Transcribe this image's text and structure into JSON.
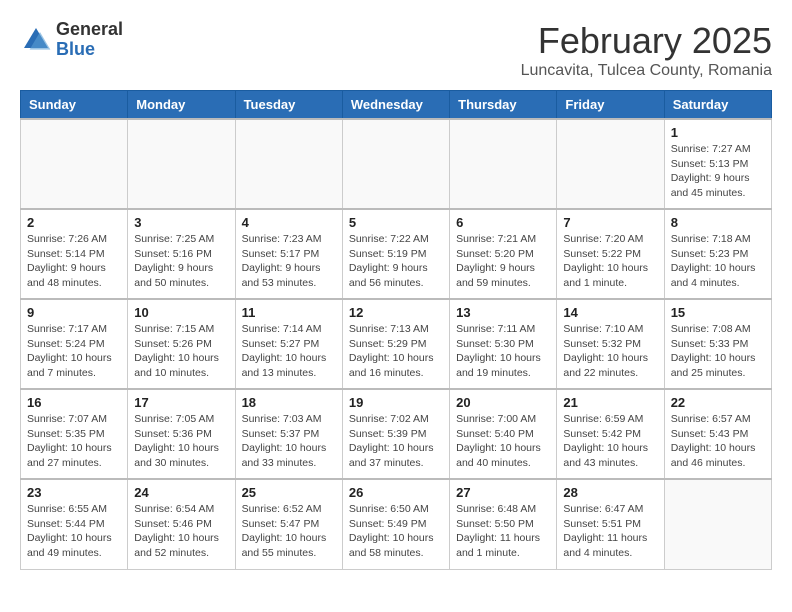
{
  "header": {
    "logo_general": "General",
    "logo_blue": "Blue",
    "month_title": "February 2025",
    "location": "Luncavita, Tulcea County, Romania"
  },
  "weekdays": [
    "Sunday",
    "Monday",
    "Tuesday",
    "Wednesday",
    "Thursday",
    "Friday",
    "Saturday"
  ],
  "weeks": [
    [
      {
        "day": "",
        "info": ""
      },
      {
        "day": "",
        "info": ""
      },
      {
        "day": "",
        "info": ""
      },
      {
        "day": "",
        "info": ""
      },
      {
        "day": "",
        "info": ""
      },
      {
        "day": "",
        "info": ""
      },
      {
        "day": "1",
        "info": "Sunrise: 7:27 AM\nSunset: 5:13 PM\nDaylight: 9 hours\nand 45 minutes."
      }
    ],
    [
      {
        "day": "2",
        "info": "Sunrise: 7:26 AM\nSunset: 5:14 PM\nDaylight: 9 hours\nand 48 minutes."
      },
      {
        "day": "3",
        "info": "Sunrise: 7:25 AM\nSunset: 5:16 PM\nDaylight: 9 hours\nand 50 minutes."
      },
      {
        "day": "4",
        "info": "Sunrise: 7:23 AM\nSunset: 5:17 PM\nDaylight: 9 hours\nand 53 minutes."
      },
      {
        "day": "5",
        "info": "Sunrise: 7:22 AM\nSunset: 5:19 PM\nDaylight: 9 hours\nand 56 minutes."
      },
      {
        "day": "6",
        "info": "Sunrise: 7:21 AM\nSunset: 5:20 PM\nDaylight: 9 hours\nand 59 minutes."
      },
      {
        "day": "7",
        "info": "Sunrise: 7:20 AM\nSunset: 5:22 PM\nDaylight: 10 hours\nand 1 minute."
      },
      {
        "day": "8",
        "info": "Sunrise: 7:18 AM\nSunset: 5:23 PM\nDaylight: 10 hours\nand 4 minutes."
      }
    ],
    [
      {
        "day": "9",
        "info": "Sunrise: 7:17 AM\nSunset: 5:24 PM\nDaylight: 10 hours\nand 7 minutes."
      },
      {
        "day": "10",
        "info": "Sunrise: 7:15 AM\nSunset: 5:26 PM\nDaylight: 10 hours\nand 10 minutes."
      },
      {
        "day": "11",
        "info": "Sunrise: 7:14 AM\nSunset: 5:27 PM\nDaylight: 10 hours\nand 13 minutes."
      },
      {
        "day": "12",
        "info": "Sunrise: 7:13 AM\nSunset: 5:29 PM\nDaylight: 10 hours\nand 16 minutes."
      },
      {
        "day": "13",
        "info": "Sunrise: 7:11 AM\nSunset: 5:30 PM\nDaylight: 10 hours\nand 19 minutes."
      },
      {
        "day": "14",
        "info": "Sunrise: 7:10 AM\nSunset: 5:32 PM\nDaylight: 10 hours\nand 22 minutes."
      },
      {
        "day": "15",
        "info": "Sunrise: 7:08 AM\nSunset: 5:33 PM\nDaylight: 10 hours\nand 25 minutes."
      }
    ],
    [
      {
        "day": "16",
        "info": "Sunrise: 7:07 AM\nSunset: 5:35 PM\nDaylight: 10 hours\nand 27 minutes."
      },
      {
        "day": "17",
        "info": "Sunrise: 7:05 AM\nSunset: 5:36 PM\nDaylight: 10 hours\nand 30 minutes."
      },
      {
        "day": "18",
        "info": "Sunrise: 7:03 AM\nSunset: 5:37 PM\nDaylight: 10 hours\nand 33 minutes."
      },
      {
        "day": "19",
        "info": "Sunrise: 7:02 AM\nSunset: 5:39 PM\nDaylight: 10 hours\nand 37 minutes."
      },
      {
        "day": "20",
        "info": "Sunrise: 7:00 AM\nSunset: 5:40 PM\nDaylight: 10 hours\nand 40 minutes."
      },
      {
        "day": "21",
        "info": "Sunrise: 6:59 AM\nSunset: 5:42 PM\nDaylight: 10 hours\nand 43 minutes."
      },
      {
        "day": "22",
        "info": "Sunrise: 6:57 AM\nSunset: 5:43 PM\nDaylight: 10 hours\nand 46 minutes."
      }
    ],
    [
      {
        "day": "23",
        "info": "Sunrise: 6:55 AM\nSunset: 5:44 PM\nDaylight: 10 hours\nand 49 minutes."
      },
      {
        "day": "24",
        "info": "Sunrise: 6:54 AM\nSunset: 5:46 PM\nDaylight: 10 hours\nand 52 minutes."
      },
      {
        "day": "25",
        "info": "Sunrise: 6:52 AM\nSunset: 5:47 PM\nDaylight: 10 hours\nand 55 minutes."
      },
      {
        "day": "26",
        "info": "Sunrise: 6:50 AM\nSunset: 5:49 PM\nDaylight: 10 hours\nand 58 minutes."
      },
      {
        "day": "27",
        "info": "Sunrise: 6:48 AM\nSunset: 5:50 PM\nDaylight: 11 hours\nand 1 minute."
      },
      {
        "day": "28",
        "info": "Sunrise: 6:47 AM\nSunset: 5:51 PM\nDaylight: 11 hours\nand 4 minutes."
      },
      {
        "day": "",
        "info": ""
      }
    ]
  ]
}
